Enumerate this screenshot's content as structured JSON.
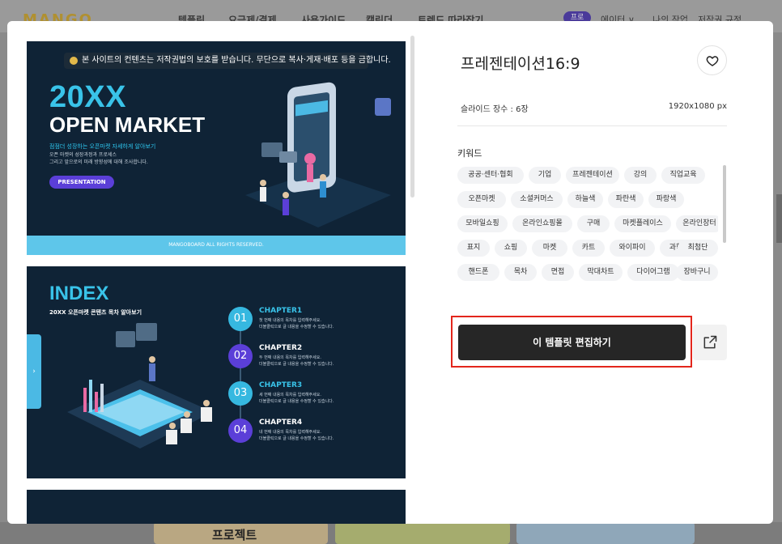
{
  "background": {
    "logo": "MANGO",
    "nav": [
      "템플릿",
      "요금제/결제",
      "사용가이드",
      "캘린더",
      "트렌드 따라잡기"
    ],
    "pill": "프로",
    "right": [
      "에이터 ∨",
      "나의 작업",
      "저작권 규정"
    ],
    "thumb_text": "프로젝트"
  },
  "preview": {
    "slide1": {
      "notice": "본 사이트의 컨텐츠는 저작권법의 보호를 받습니다. 무단으로 복사·게재·배포 등을 금합니다.",
      "title_line1": "20XX",
      "title_line2": "OPEN MARKET",
      "subtitle": "점점더 성장하는 오픈마켓 자세하게 알아보기",
      "desc_line1": "오픈 마켓의 성장과정과 프로세스",
      "desc_line2": "그리고 앞으로의 미래 방향성에 대해 조사합니다.",
      "button": "PRESENTATION",
      "footer": "MANGOBOARD ALL RIGHTS RESERVED."
    },
    "slide2": {
      "title": "INDEX",
      "subtitle": "20XX 오픈마켓 콘텐츠 목차 알아보기",
      "chapters": [
        {
          "num": "01",
          "title": "CHAPTER1",
          "desc1": "첫 번째 내용의 목차를 입력해주세요.",
          "desc2": "더블클릭으로 글 내용을 수정할 수 있습니다."
        },
        {
          "num": "02",
          "title": "CHAPTER2",
          "desc1": "두 번째 내용의 목차를 입력해주세요.",
          "desc2": "더블클릭으로 글 내용을 수정할 수 있습니다."
        },
        {
          "num": "03",
          "title": "CHAPTER3",
          "desc1": "세 번째 내용의 목차를 입력해주세요.",
          "desc2": "더블클릭으로 글 내용을 수정할 수 있습니다."
        },
        {
          "num": "04",
          "title": "CHAPTER4",
          "desc1": "네 번째 내용의 목차를 입력해주세요.",
          "desc2": "더블클릭으로 글 내용을 수정할 수 있습니다."
        }
      ],
      "tab_icon": "›"
    }
  },
  "detail": {
    "title": "프레젠테이션16:9",
    "like_icon": "heart-icon",
    "slide_count": "슬라이드 장수 : 6장",
    "resolution": "1920x1080 px",
    "keywords_label": "키워드",
    "keywords": [
      "공공·센터·협회",
      "기업",
      "프레젠테이션",
      "강의",
      "직업교육",
      "오픈마켓",
      "소셜커머스",
      "하늘색",
      "파란색",
      "파랑색",
      "모바일쇼핑",
      "온라인쇼핑몰",
      "구매",
      "마켓플레이스",
      "온라인장터",
      "표지",
      "쇼핑",
      "마켓",
      "카트",
      "와이파이",
      "과학",
      "최첨단",
      "핸드폰",
      "목차",
      "면접",
      "막대차트",
      "다이어그램",
      "장바구니"
    ],
    "edit_button": "이 템플릿 편집하기",
    "share_icon": "external-link-icon"
  },
  "colors": {
    "accent_blue": "#39c3e9",
    "highlight_red": "#e3261c",
    "dark_button": "#262626",
    "chapter_colors": [
      "#36b8e0",
      "#5b3fd8",
      "#36b8e0",
      "#5b3fd8"
    ]
  }
}
